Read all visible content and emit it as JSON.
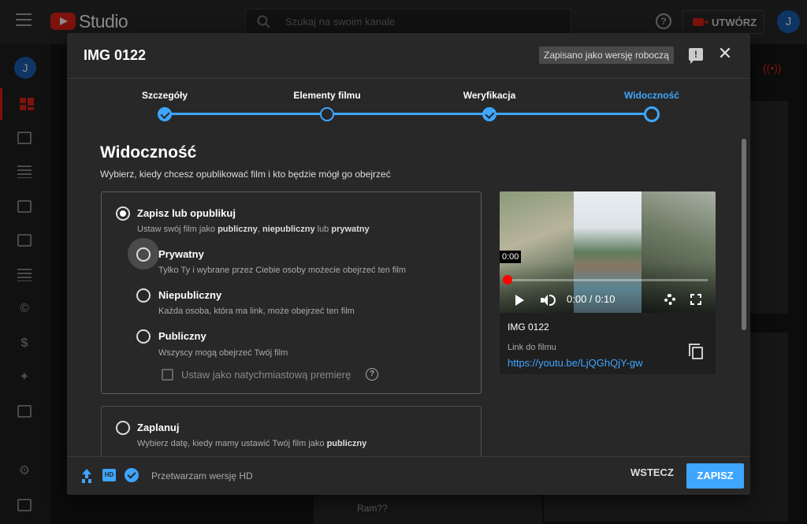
{
  "app": {
    "brand": "Studio",
    "search_placeholder": "Szukaj na swoim kanale",
    "create_label": "UTWÓRZ",
    "avatar_letter": "J",
    "background_comment": "Ram??"
  },
  "dialog": {
    "title": "IMG 0122",
    "draft_status": "Zapisano jako wersję roboczą",
    "steps": [
      {
        "label": "Szczegóły",
        "state": "done"
      },
      {
        "label": "Elementy filmu",
        "state": "visited"
      },
      {
        "label": "Weryfikacja",
        "state": "done"
      },
      {
        "label": "Widoczność",
        "state": "active"
      }
    ],
    "section_title": "Widoczność",
    "section_subtitle": "Wybierz, kiedy chcesz opublikować film i kto będzie mógł go obejrzeć",
    "save_publish": {
      "title": "Zapisz lub opublikuj",
      "desc_prefix": "Ustaw swój film jako ",
      "desc_b1": "publiczny",
      "desc_sep": ", ",
      "desc_b2": "niepubliczny",
      "desc_mid": " lub ",
      "desc_b3": "prywatny"
    },
    "options": [
      {
        "title": "Prywatny",
        "desc": "Tylko Ty i wybrane przez Ciebie osoby możecie obejrzeć ten film"
      },
      {
        "title": "Niepubliczny",
        "desc": "Każda osoba, która ma link, może obejrzeć ten film"
      },
      {
        "title": "Publiczny",
        "desc": "Wszyscy mogą obejrzeć Twój film"
      }
    ],
    "premiere_label": "Ustaw jako natychmiastową premierę",
    "schedule": {
      "title": "Zaplanuj",
      "desc_prefix": "Wybierz datę, kiedy mamy ustawić Twój film jako ",
      "desc_bold": "publiczny"
    },
    "video": {
      "tooltip_time": "0:00",
      "time_display": "0:00 / 0:10",
      "name": "IMG 0122",
      "link_label": "Link do filmu",
      "link_url": "https://youtu.be/LjQGhQjY-gw"
    },
    "footer": {
      "hd_badge": "HD",
      "status": "Przetwarzam wersję HD",
      "back_label": "WSTECZ",
      "save_label": "ZAPISZ"
    }
  },
  "colors": {
    "accent": "#3ea6ff",
    "brand_red": "#e62117",
    "dialog_bg": "#282828"
  }
}
